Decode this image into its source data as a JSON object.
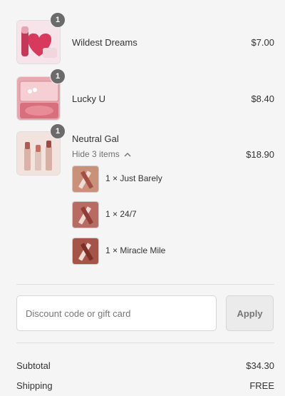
{
  "items": [
    {
      "name": "Wildest Dreams",
      "price": "$7.00",
      "quantity": "1",
      "image": "lip-blush-heart-product-image"
    },
    {
      "name": "Lucky U",
      "price": "$8.40",
      "quantity": "1",
      "image": "pink-blush-compact-product-image"
    },
    {
      "name": "Neutral Gal",
      "price": "$18.90",
      "quantity": "1",
      "image": "lipstick-set-product-image",
      "toggle_label": "Hide 3 items",
      "toggle_icon": "chevron-up-icon",
      "bundle_items": [
        {
          "label": "1 × Just Barely",
          "color": "#c9907a"
        },
        {
          "label": "1 × 24/7",
          "color": "#b86b63"
        },
        {
          "label": "1 × Miracle Mile",
          "color": "#a75448"
        }
      ]
    }
  ],
  "discount": {
    "placeholder": "Discount code or gift card",
    "apply_label": "Apply"
  },
  "summary": {
    "subtotal_label": "Subtotal",
    "subtotal_value": "$34.30",
    "shipping_label": "Shipping",
    "shipping_value": "FREE"
  },
  "colors": {
    "background": "#f5f5f5",
    "badge": "#6b6b6b",
    "apply_button": "#ebebeb"
  }
}
